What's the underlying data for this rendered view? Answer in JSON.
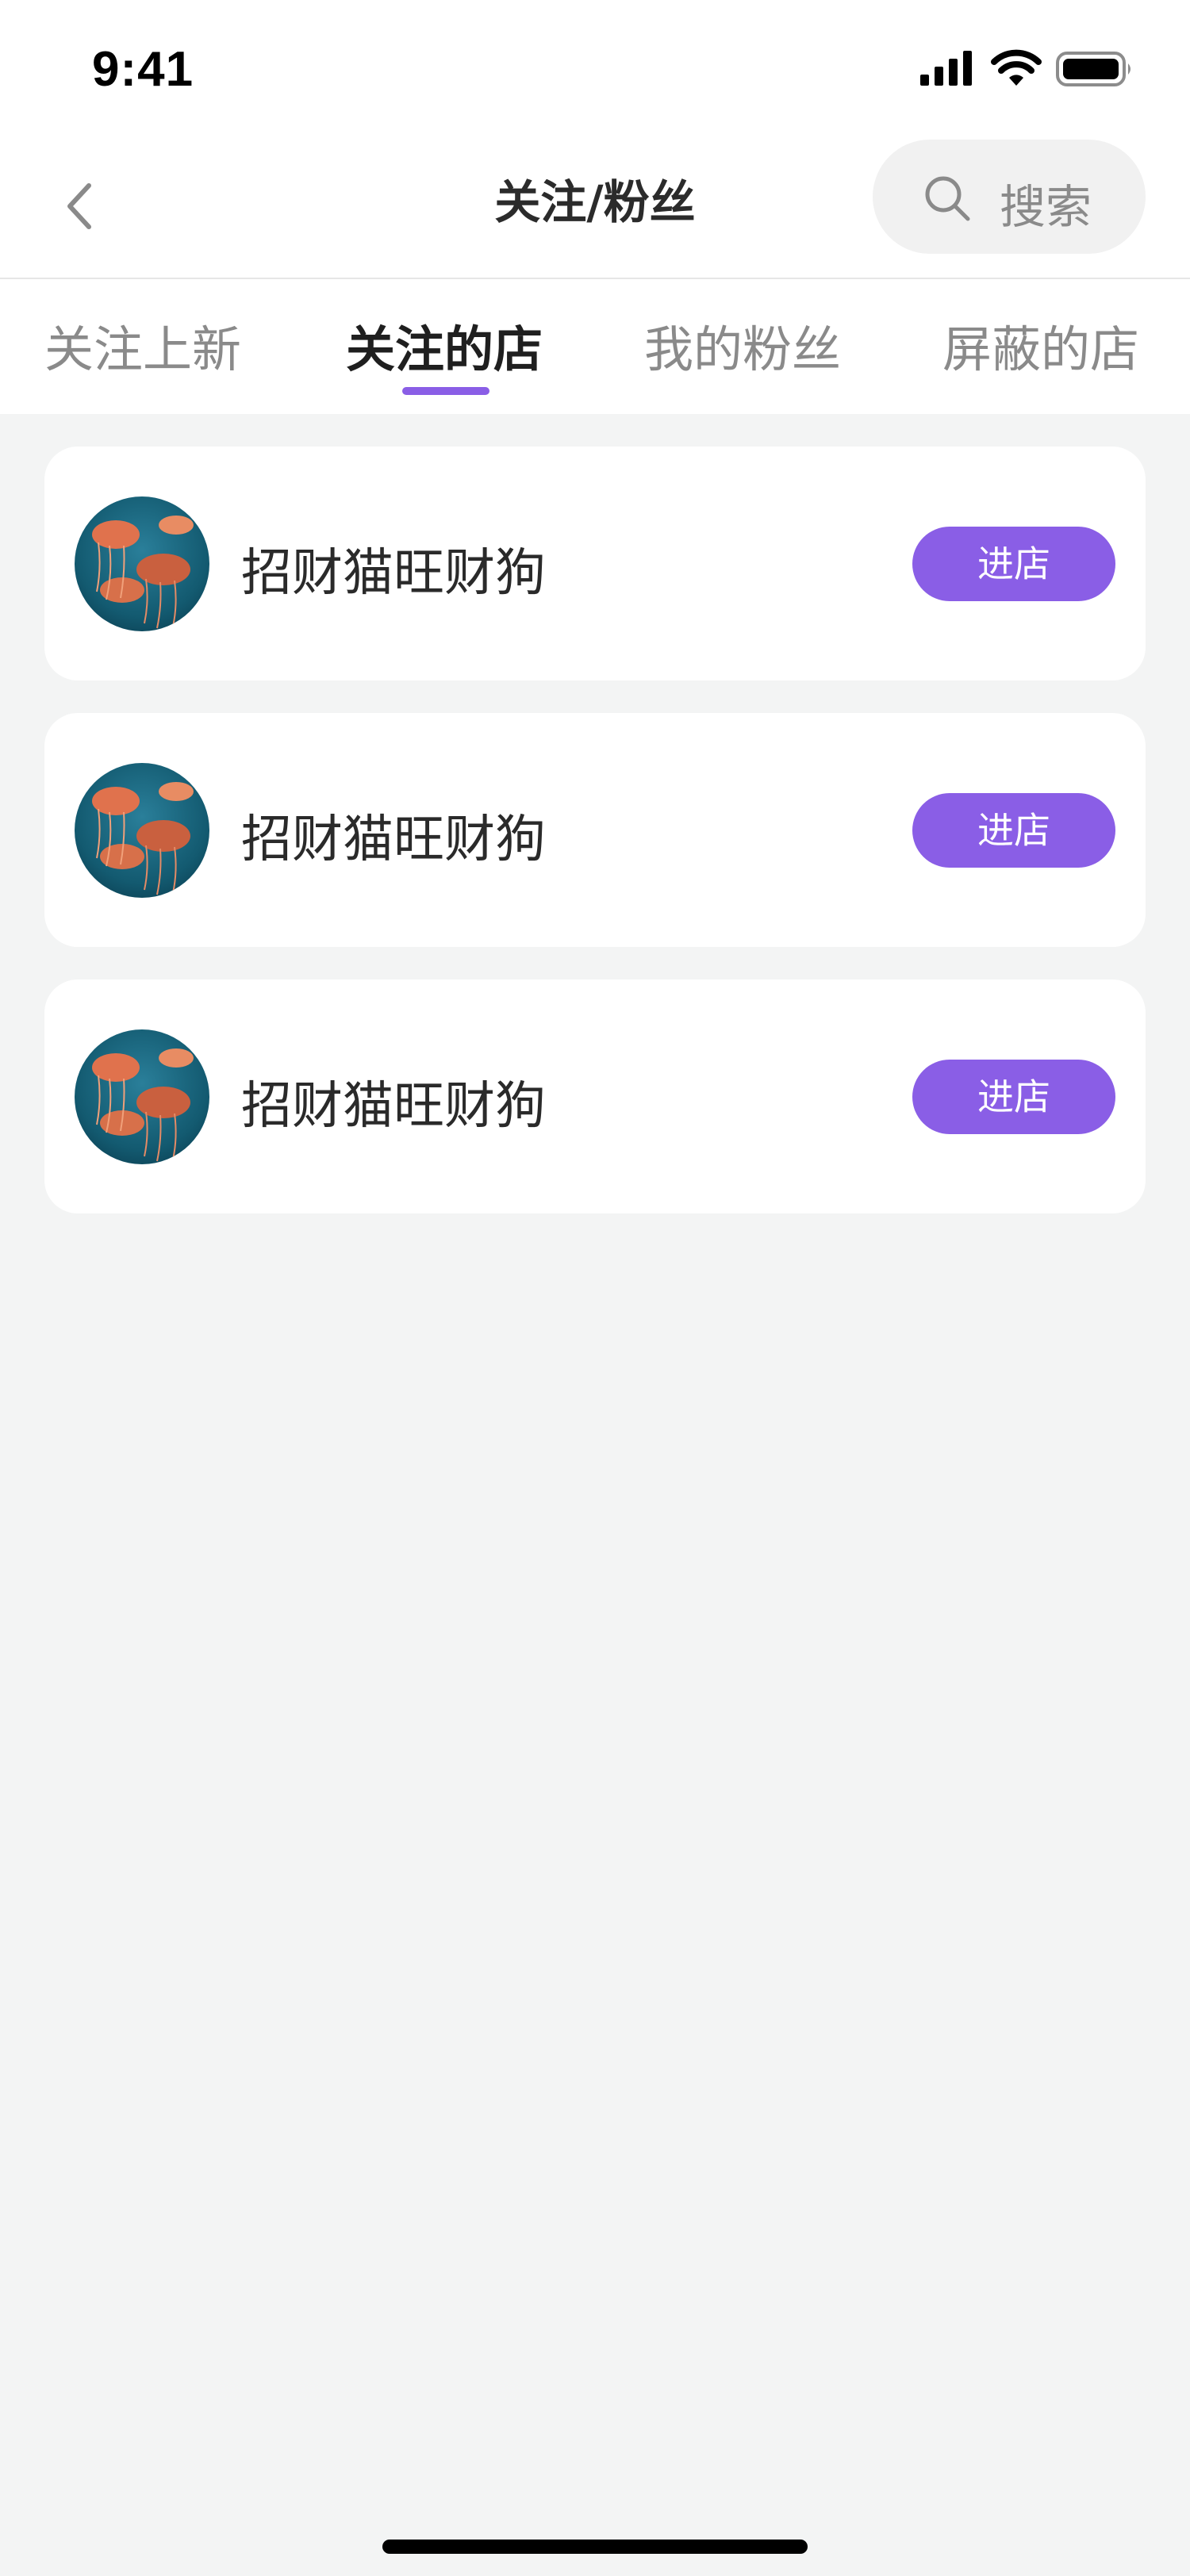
{
  "status_bar": {
    "time": "9:41"
  },
  "header": {
    "title": "关注/粉丝",
    "search_label": "搜索"
  },
  "tabs": [
    {
      "label": "关注上新",
      "active": false
    },
    {
      "label": "关注的店",
      "active": true
    },
    {
      "label": "我的粉丝",
      "active": false
    },
    {
      "label": "屏蔽的店",
      "active": false
    }
  ],
  "stores": [
    {
      "name": "招财猫旺财狗",
      "action_label": "进店"
    },
    {
      "name": "招财猫旺财狗",
      "action_label": "进店"
    },
    {
      "name": "招财猫旺财狗",
      "action_label": "进店"
    }
  ],
  "colors": {
    "accent": "#8a5ee6",
    "background": "#f3f4f4"
  }
}
